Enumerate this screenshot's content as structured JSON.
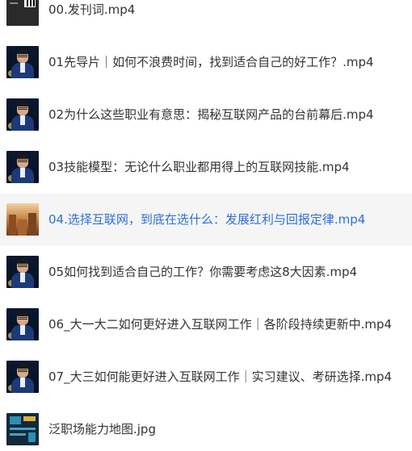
{
  "files": [
    {
      "name": "00.发刊词.mp4",
      "thumb": "qr-code-thumbnail",
      "active": false
    },
    {
      "name": "01先导片｜如何不浪费时间，找到适合自己的好工作？.mp4",
      "thumb": "presenter-video-thumbnail",
      "active": false
    },
    {
      "name": "02为什么这些职业有意思：揭秘互联网产品的台前幕后.mp4",
      "thumb": "presenter-video-thumbnail",
      "active": false
    },
    {
      "name": "03技能模型：无论什么职业都用得上的互联网技能.mp4",
      "thumb": "presenter-video-thumbnail",
      "active": false
    },
    {
      "name": "04.选择互联网，到底在选什么：发展红利与回报定律.mp4",
      "thumb": "city-scene-thumbnail",
      "active": true
    },
    {
      "name": "05如何找到适合自己的工作？你需要考虑这8大因素.mp4",
      "thumb": "presenter-video-thumbnail",
      "active": false
    },
    {
      "name": "06_大一大二如何更好进入互联网工作｜各阶段持续更新中.mp4",
      "thumb": "presenter-video-thumbnail",
      "active": false
    },
    {
      "name": "07_大三如何能更好进入互联网工作｜实习建议、考研选择.mp4",
      "thumb": "presenter-video-thumbnail",
      "active": false
    },
    {
      "name": "泛职场能力地图.jpg",
      "thumb": "map-image-thumbnail",
      "active": false
    }
  ],
  "colors": {
    "active_text": "#2e6fd8",
    "active_row_bg": "#f5f5f5",
    "text": "#333333"
  }
}
